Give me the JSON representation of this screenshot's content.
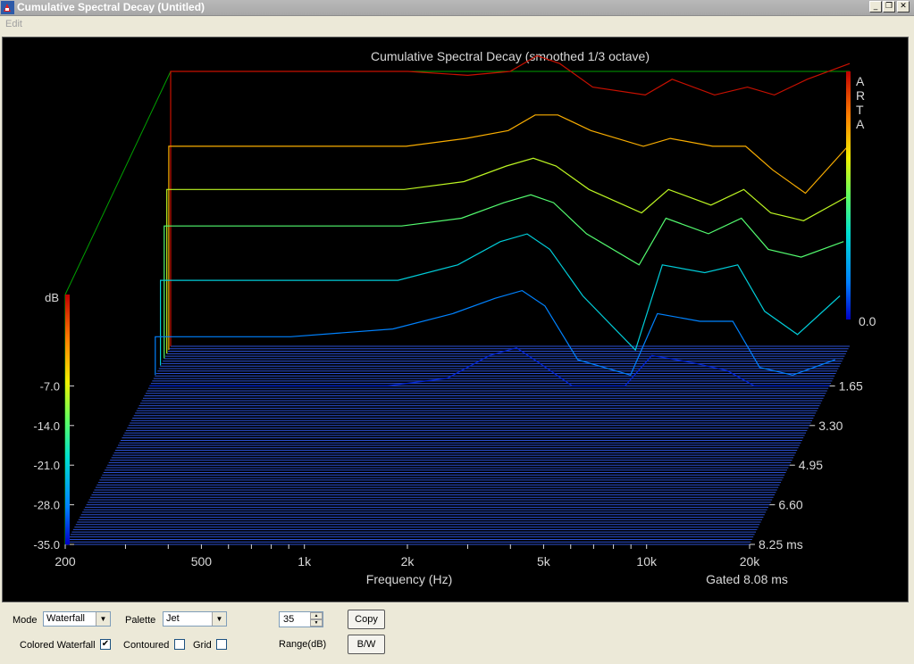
{
  "window": {
    "title": "Cumulative Spectral Decay  (Untitled)"
  },
  "menu": {
    "edit": "Edit"
  },
  "chart": {
    "title": "Cumulative Spectral Decay (smoothed 1/3 octave)",
    "brand_letters": [
      "A",
      "R",
      "T",
      "A"
    ],
    "colorbar_title": "dB",
    "colorbar_zero": "0.0",
    "xlabel": "Frequency (Hz)",
    "gated_label": "Gated 8.08 ms"
  },
  "chart_data": {
    "type": "waterfall",
    "title": "Cumulative Spectral Decay (smoothed 1/3 octave)",
    "xlabel": "Frequency (Hz)",
    "x_scale": "log",
    "x_tick_values": [
      200,
      500,
      1000,
      2000,
      5000,
      10000,
      20000
    ],
    "x_tick_labels": [
      "200",
      "500",
      "1k",
      "2k",
      "5k",
      "10k",
      "20k"
    ],
    "z_label": "dB",
    "z_ticks": [
      "-7.0",
      "-14.0",
      "-21.0",
      "-28.0",
      "-35.0"
    ],
    "z_range": [
      -35,
      0
    ],
    "time_ticks": [
      "1.65",
      "3.30",
      "4.95",
      "6.60",
      "8.25 ms"
    ],
    "time_range_ms": [
      0,
      8.25
    ],
    "gated_ms": 8.08,
    "palette": "Jet",
    "series": [
      {
        "t_ms": 0.0,
        "f": [
          200,
          500,
          1000,
          1500,
          2000,
          2400,
          2800,
          3500,
          5000,
          6000,
          8000,
          10000,
          12000,
          15000,
          20000
        ],
        "db": [
          0,
          0,
          0,
          -0.5,
          0,
          2,
          1,
          -2,
          -3,
          -1,
          -3,
          -2,
          -3,
          -1,
          1
        ]
      },
      {
        "t_ms": 0.15,
        "f": [
          200,
          500,
          1000,
          1500,
          2000,
          2400,
          2800,
          3500,
          5000,
          6000,
          8000,
          10000,
          12000,
          15000,
          20000
        ],
        "db": [
          -9,
          -9,
          -9,
          -8,
          -7,
          -5,
          -5,
          -7,
          -9,
          -8,
          -9,
          -9,
          -12,
          -15,
          -9
        ]
      },
      {
        "t_ms": 0.3,
        "f": [
          200,
          500,
          1000,
          1500,
          2000,
          2400,
          2800,
          3500,
          5000,
          6000,
          8000,
          10000,
          12000,
          15000,
          20000
        ],
        "db": [
          -14,
          -14,
          -14,
          -13,
          -11,
          -10,
          -11,
          -14,
          -17,
          -14,
          -16,
          -14,
          -17,
          -18,
          -15
        ]
      },
      {
        "t_ms": 0.5,
        "f": [
          200,
          500,
          1000,
          1500,
          2000,
          2400,
          2800,
          3500,
          5000,
          6000,
          8000,
          10000,
          12000,
          15000,
          20000
        ],
        "db": [
          -18,
          -18,
          -18,
          -17,
          -15,
          -14,
          -15,
          -19,
          -23,
          -17,
          -19,
          -17,
          -21,
          -22,
          -20
        ]
      },
      {
        "t_ms": 0.8,
        "f": [
          200,
          500,
          1000,
          1500,
          2000,
          2400,
          2800,
          3500,
          5000,
          6000,
          8000,
          10000,
          12000,
          15000,
          20000
        ],
        "db": [
          -24,
          -24,
          -24,
          -22,
          -19,
          -18,
          -20,
          -26,
          -33,
          -22,
          -23,
          -22,
          -28,
          -31,
          -26
        ]
      },
      {
        "t_ms": 1.2,
        "f": [
          200,
          500,
          1000,
          1500,
          2000,
          2400,
          2800,
          3500,
          5000,
          6000,
          8000,
          10000,
          12000,
          15000,
          20000
        ],
        "db": [
          -30,
          -30,
          -29,
          -27,
          -25,
          -24,
          -26,
          -33,
          -35,
          -27,
          -28,
          -28,
          -34,
          -35,
          -33
        ]
      },
      {
        "t_ms": 1.65,
        "f": [
          200,
          500,
          1000,
          1500,
          2000,
          2400,
          2800,
          3500,
          5000,
          6000,
          8000,
          10000,
          12000,
          15000,
          20000
        ],
        "db": [
          -35,
          -35,
          -35,
          -34,
          -31,
          -30,
          -32,
          -35,
          -35,
          -31,
          -32,
          -33,
          -35,
          -35,
          -35
        ]
      }
    ]
  },
  "controls": {
    "mode_label": "Mode",
    "mode_value": "Waterfall",
    "palette_label": "Palette",
    "palette_value": "Jet",
    "range_value": "35",
    "range_label": "Range(dB)",
    "copy_button": "Copy",
    "bw_button": "B/W",
    "colored_waterfall_label": "Colored Waterfall",
    "colored_waterfall_checked": true,
    "contoured_label": "Contoured",
    "contoured_checked": false,
    "grid_label": "Grid",
    "grid_checked": false
  },
  "colors": {
    "window_bg": "#ece9d8",
    "plot_bg": "#000000",
    "frame_green": "#00a000",
    "floor_blue": "#2b4fd0"
  }
}
